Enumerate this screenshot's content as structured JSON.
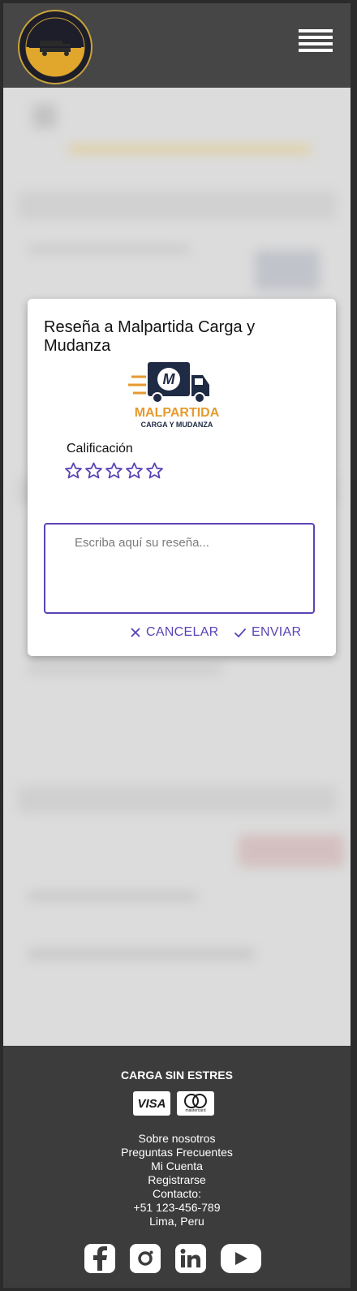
{
  "header": {
    "logo_alt": "CARGA SIN ESTRES",
    "menu_icon": "hamburger-menu-icon"
  },
  "modal": {
    "title": "Reseña a Malpartida Carga y Mudanza",
    "company_logo_name": "MALPARTIDA",
    "company_logo_tagline": "CARGA Y MUDANZA",
    "rating_label": "Calificación",
    "rating_value": 0,
    "rating_max": 5,
    "review_placeholder": "Escriba aquí su reseña...",
    "review_value": "",
    "cancel_label": "CANCELAR",
    "send_label": "ENVIAR",
    "accent_color": "#5b43b5"
  },
  "footer": {
    "brand": "CARGA SIN ESTRES",
    "payment_cards": [
      "VISA",
      "mastercard"
    ],
    "links": [
      "Sobre nosotros",
      "Preguntas Frecuentes",
      "Mi Cuenta",
      "Registrarse"
    ],
    "contact_label": "Contacto:",
    "phone": "+51 123-456-789",
    "location": "Lima, Peru",
    "social_icons": [
      "facebook-icon",
      "instagram-icon",
      "linkedin-icon",
      "youtube-icon"
    ]
  }
}
